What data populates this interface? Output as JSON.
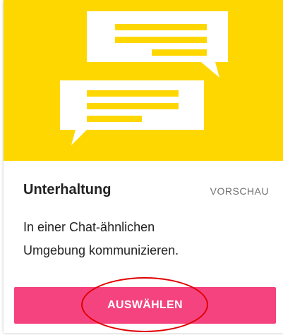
{
  "card": {
    "title": "Unterhaltung",
    "badge": "VORSCHAU",
    "description_line1": "In einer Chat-ähnlichen",
    "description_line2": "Umgebung kommunizieren.",
    "button_label": "AUSWÄHLEN",
    "hero_icon": "chat-bubbles-illustration"
  },
  "colors": {
    "hero_background": "#ffd700",
    "button_background": "#f4437f",
    "annotation_circle": "#e00000"
  }
}
